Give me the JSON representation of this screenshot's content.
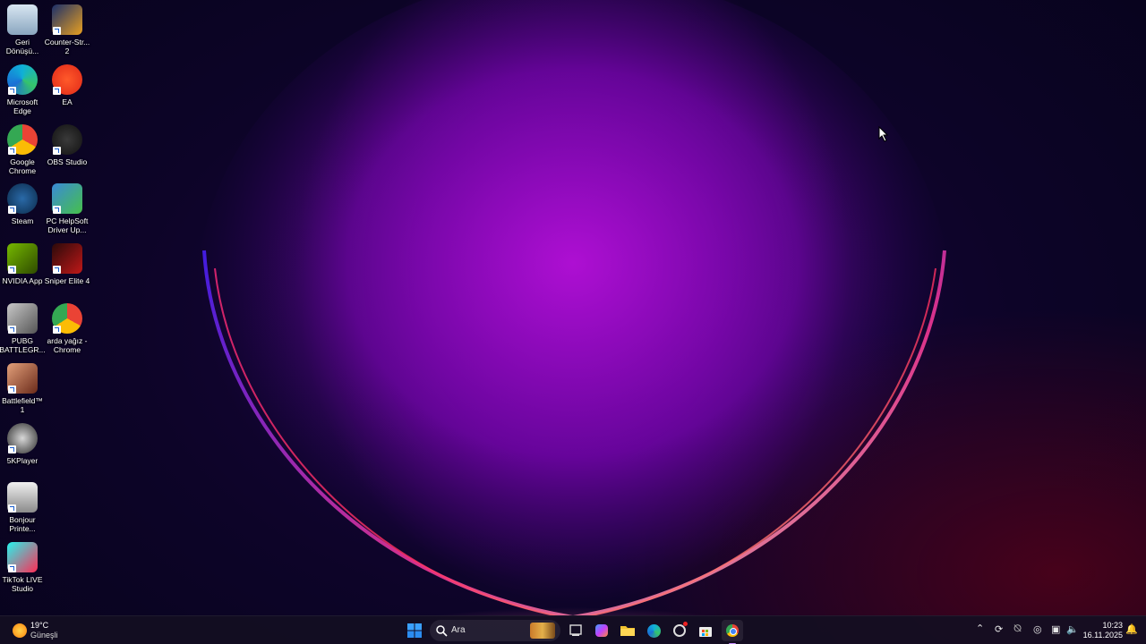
{
  "desktop_icons": [
    {
      "label": "Geri Dönüşü...",
      "icon": "recycle-bin-icon"
    },
    {
      "label": "Counter-Str... 2",
      "icon": "counter-strike-icon"
    },
    {
      "label": "Microsoft Edge",
      "icon": "edge-icon"
    },
    {
      "label": "EA",
      "icon": "ea-icon"
    },
    {
      "label": "Google Chrome",
      "icon": "chrome-icon"
    },
    {
      "label": "OBS Studio",
      "icon": "obs-icon"
    },
    {
      "label": "Steam",
      "icon": "steam-icon"
    },
    {
      "label": "PC HelpSoft Driver Up...",
      "icon": "driver-updater-icon"
    },
    {
      "label": "NVIDIA App",
      "icon": "nvidia-icon"
    },
    {
      "label": "Sniper Elite 4",
      "icon": "sniper-elite-icon"
    },
    {
      "label": "PUBG BATTLEGR...",
      "icon": "pubg-icon"
    },
    {
      "label": "arda yağız - Chrome",
      "icon": "chrome-profile-icon"
    },
    {
      "label": "Battlefield™ 1",
      "icon": "battlefield-icon"
    },
    {
      "label": "5KPlayer",
      "icon": "5kplayer-icon"
    },
    {
      "label": "Bonjour Printe...",
      "icon": "printer-icon"
    },
    {
      "label": "TikTok LIVE Studio",
      "icon": "tiktok-icon"
    }
  ],
  "taskbar": {
    "weather_temp": "19°C",
    "weather_desc": "Güneşli",
    "search_placeholder": "Ara",
    "time": "10:23",
    "date": "16.11.2025"
  },
  "colors": {
    "taskbar_bg": "#140e22",
    "start_blue": "#1f8fff"
  }
}
